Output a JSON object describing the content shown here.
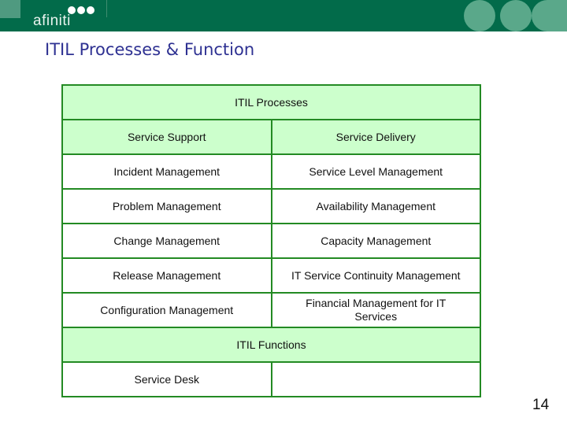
{
  "brand": {
    "logo_text": "afiniti",
    "colors": {
      "header_green": "#026b4a",
      "cell_green": "#ccffcc",
      "border_green": "#238a23",
      "title_blue": "#2e3192"
    }
  },
  "slide": {
    "title": "ITIL Processes & Function",
    "page_number": "14"
  },
  "table": {
    "processes_header": "ITIL Processes",
    "columns": [
      "Service Support",
      "Service Delivery"
    ],
    "rows": [
      [
        "Incident Management",
        "Service Level Management"
      ],
      [
        "Problem Management",
        "Availability Management"
      ],
      [
        "Change Management",
        "Capacity Management"
      ],
      [
        "Release Management",
        "IT Service Continuity Management"
      ],
      [
        "Configuration Management",
        "Financial Management for IT Services"
      ]
    ],
    "functions_header": "ITIL Functions",
    "functions": [
      "Service Desk",
      ""
    ]
  }
}
